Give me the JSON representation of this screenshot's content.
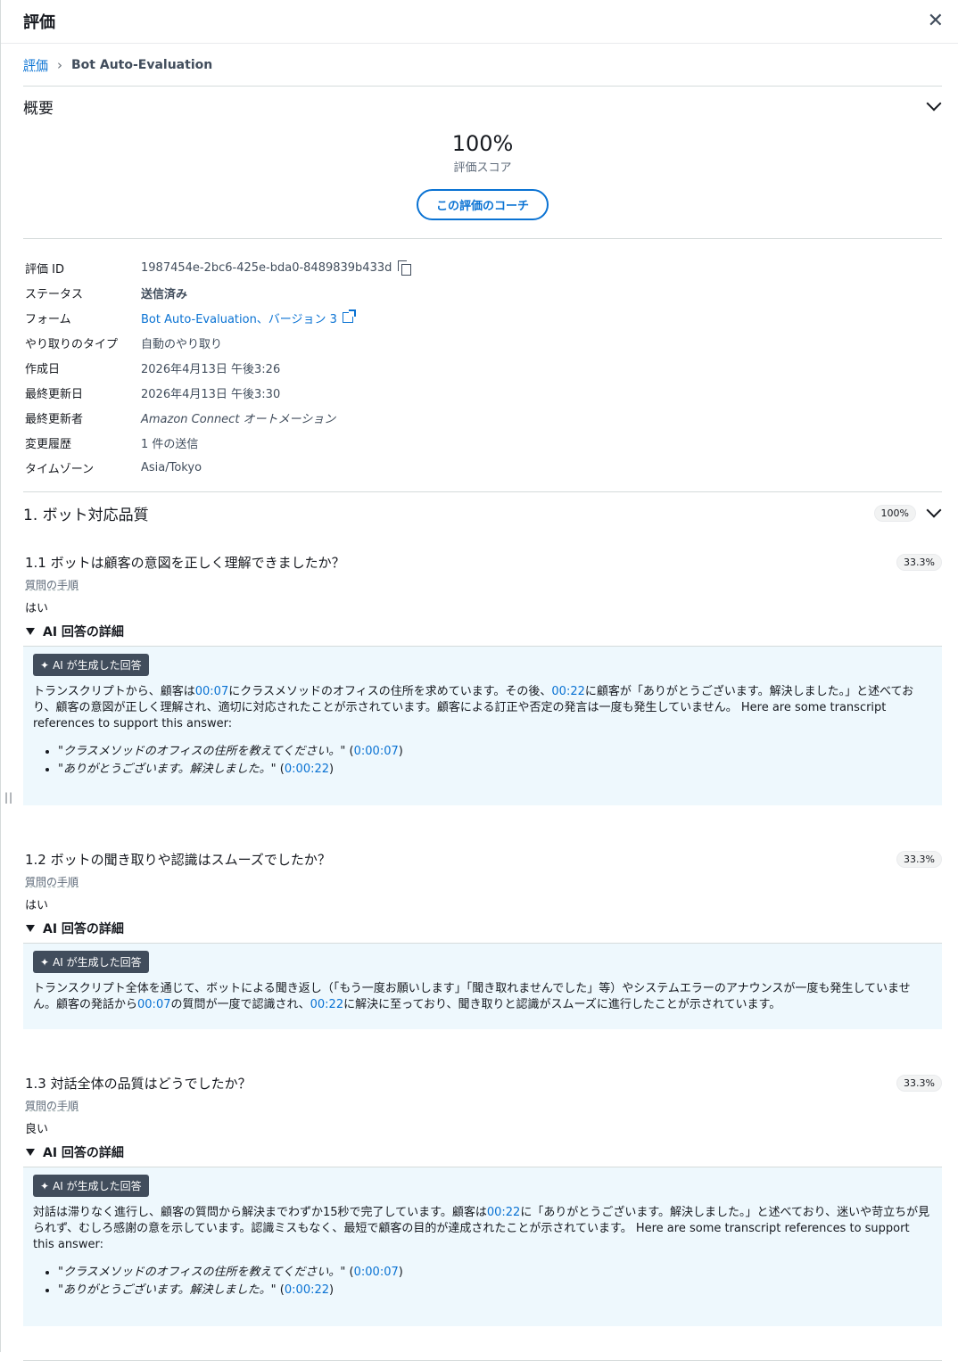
{
  "header": {
    "title": "評価",
    "close_icon": "close-icon"
  },
  "breadcrumb": {
    "root": "評価",
    "current": "Bot Auto-Evaluation"
  },
  "overview": {
    "heading": "概要",
    "score": "100%",
    "score_label": "評価スコア",
    "coach_button": "この評価のコーチ"
  },
  "details": {
    "eval_id_label": "評価 ID",
    "eval_id": "1987454e-2bc6-425e-bda0-8489839b433d",
    "status_label": "ステータス",
    "status": "送信済み",
    "form_label": "フォーム",
    "form": "Bot Auto-Evaluation、バージョン 3",
    "type_label": "やり取りのタイプ",
    "type": "自動のやり取り",
    "created_label": "作成日",
    "created": "2026年4月13日 午後3:26",
    "updated_label": "最終更新日",
    "updated": "2026年4月13日 午後3:30",
    "updated_by_label": "最終更新者",
    "updated_by": "Amazon Connect オートメーション",
    "history_label": "変更履歴",
    "history": "1 件の送信",
    "tz_label": "タイムゾーン",
    "tz": "Asia/Tokyo"
  },
  "section1": {
    "title": "1. ボット対応品質",
    "score": "100%",
    "questions": [
      {
        "title": "1.1 ボットは顧客の意図を正しく理解できましたか？",
        "score": "33.3%",
        "steps": "質問の手順",
        "answer": "はい",
        "ai_heading": "AI 回答の詳細",
        "ai_tag": "AI が生成した回答",
        "text": {
          "p1": "トランスクリプトから、顧客は",
          "t1": "00:07",
          "p2": "にクラスメソッドのオフィスの住所を求めています。その後、",
          "t2": "00:22",
          "p3": "に顧客が「ありがとうございます。解決しました。」と述べており、顧客の意図が正しく理解され、適切に対応されたことが示されています。顧客による訂正や否定の発言は一度も発生していません。 Here are some transcript references to support this answer:"
        },
        "refs": [
          {
            "quote": "\"クラスメソッドのオフィスの住所を教えてください。\"",
            "ts": "0:00:07"
          },
          {
            "quote": "\"ありがとうございます。解決しました。\"",
            "ts": "0:00:22"
          }
        ]
      },
      {
        "title": "1.2 ボットの聞き取りや認識はスムーズでしたか？",
        "score": "33.3%",
        "steps": "質問の手順",
        "answer": "はい",
        "ai_heading": "AI 回答の詳細",
        "ai_tag": "AI が生成した回答",
        "text": {
          "p1": "トランスクリプト全体を通じて、ボットによる聞き返し（「もう一度お願いします」「聞き取れませんでした」等）やシステムエラーのアナウンスが一度も発生していません。顧客の発話から",
          "t1": "00:07",
          "p2": "の質問が一度で認識され、",
          "t2": "00:22",
          "p3": "に解決に至っており、聞き取りと認識がスムーズに進行したことが示されています。"
        }
      },
      {
        "title": "1.3 対話全体の品質はどうでしたか？",
        "score": "33.3%",
        "steps": "質問の手順",
        "answer": "良い",
        "ai_heading": "AI 回答の詳細",
        "ai_tag": "AI が生成した回答",
        "text": {
          "p1": "対話は滞りなく進行し、顧客の質問から解決までわずか15秒で完了しています。顧客は",
          "t1": "00:22",
          "p2": "に「ありがとうございます。解決しました。」と述べており、迷いや苛立ちが見られず、むしろ感謝の意を示しています。認識ミスもなく、最短で顧客の目的が達成されたことが示されています。 Here are some transcript references to support this answer:"
        },
        "refs": [
          {
            "quote": "\"クラスメソッドのオフィスの住所を教えてください。\"",
            "ts": "0:00:07"
          },
          {
            "quote": "\"ありがとうございます。解決しました。\"",
            "ts": "0:00:22"
          }
        ]
      }
    ]
  },
  "colors": {
    "link": "#0972d3",
    "ai_box_bg": "#eef8fd",
    "ai_tag_bg": "#414d5c"
  }
}
